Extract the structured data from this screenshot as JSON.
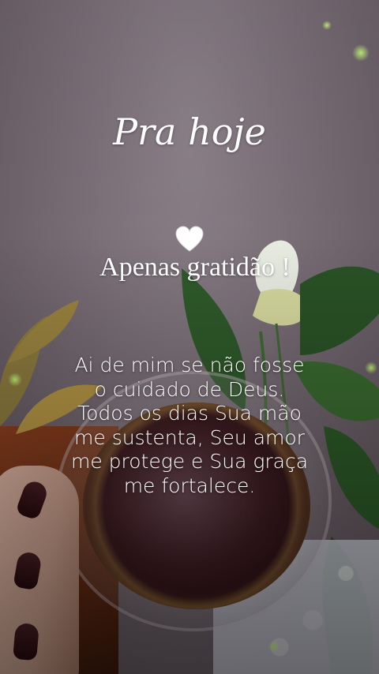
{
  "title": "Pra hoje",
  "heart_icon": "white-heart-icon",
  "subtitle": "Apenas gratidão !",
  "message_lines": [
    "Ai de mim se não fosse",
    "o cuidado de Deus.",
    "Todos os dias Sua mão",
    "me sustenta, Seu amor",
    "me protege e Sua graça",
    "me fortalece."
  ],
  "colors": {
    "text": "#ffffff",
    "wall": "#7a6e76",
    "coffee": "#3f1d23",
    "leaf": "#2f5a2a"
  }
}
